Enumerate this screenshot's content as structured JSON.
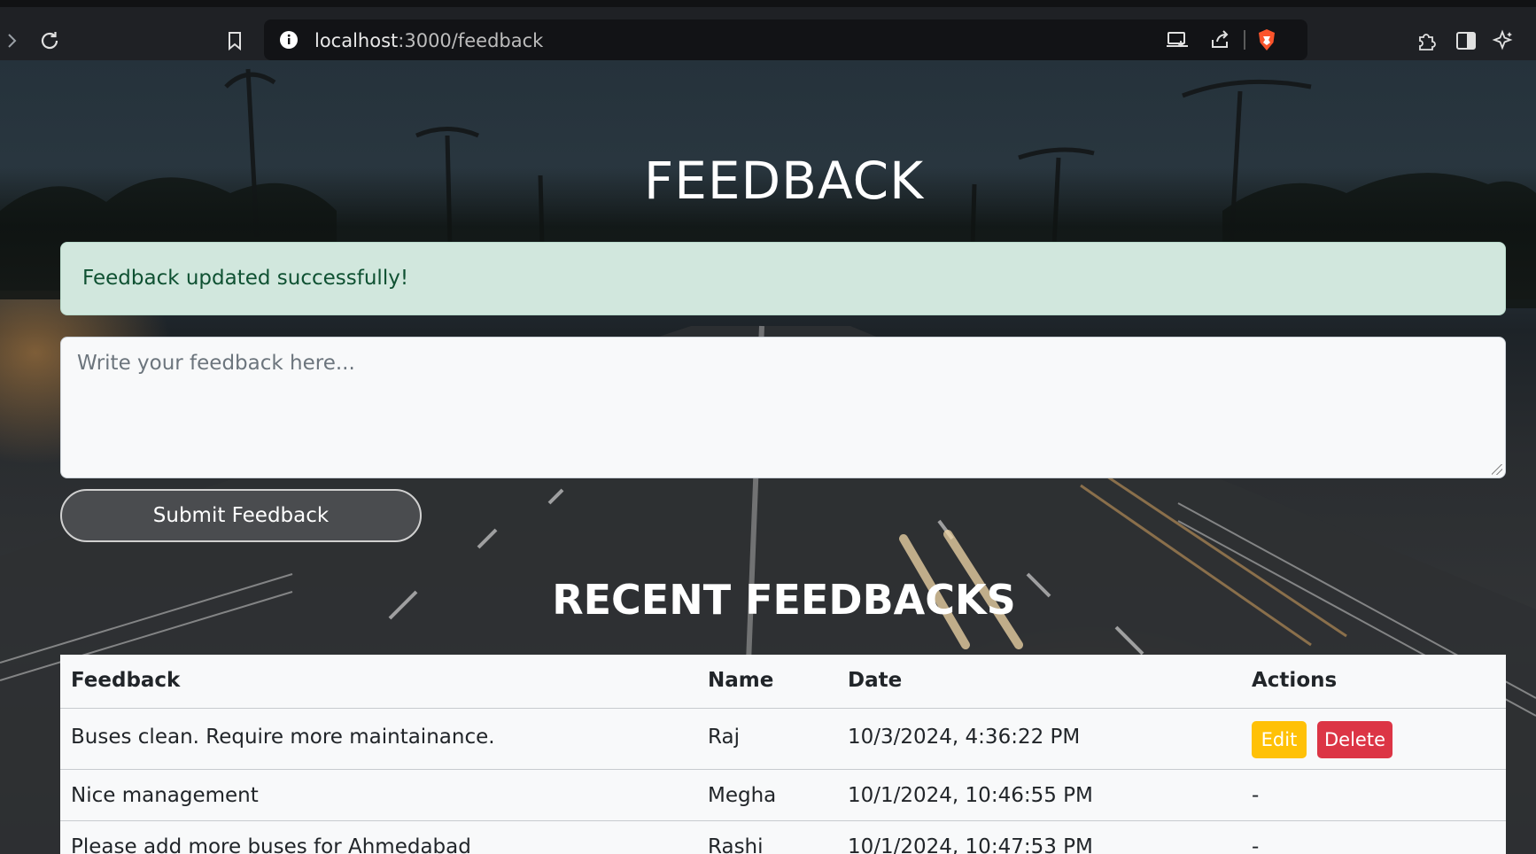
{
  "browser": {
    "url_host": "localhost",
    "url_path": ":3000/feedback"
  },
  "page": {
    "title": "FEEDBACK",
    "alert": "Feedback updated successfully!",
    "feedback_placeholder": "Write your feedback here...",
    "submit_label": "Submit Feedback",
    "recent_title": "RECENT FEEDBACKS"
  },
  "table": {
    "headers": [
      "Feedback",
      "Name",
      "Date",
      "Actions"
    ],
    "rows": [
      {
        "feedback": "Buses clean. Require more maintainance.",
        "name": "Raj",
        "date": "10/3/2024, 4:36:22 PM",
        "actions": "",
        "edit": "Edit",
        "delete": "Delete"
      },
      {
        "feedback": "Nice management",
        "name": "Megha",
        "date": "10/1/2024, 10:46:55 PM",
        "actions": "-"
      },
      {
        "feedback": "Please add more buses for Ahmedabad",
        "name": "Rashi",
        "date": "10/1/2024, 10:47:53 PM",
        "actions": "-"
      }
    ]
  },
  "colors": {
    "alert_bg": "#d1e7dd",
    "alert_text": "#0f5132",
    "edit_button": "#ffc107",
    "delete_button": "#dc3545",
    "submit_button": "#4a4c4f"
  },
  "icons": [
    "forward-icon",
    "reload-icon",
    "bookmark-icon",
    "info-icon",
    "cast-icon",
    "share-icon",
    "brave-shield-icon",
    "extensions-icon",
    "sidebar-icon",
    "leo-icon"
  ]
}
